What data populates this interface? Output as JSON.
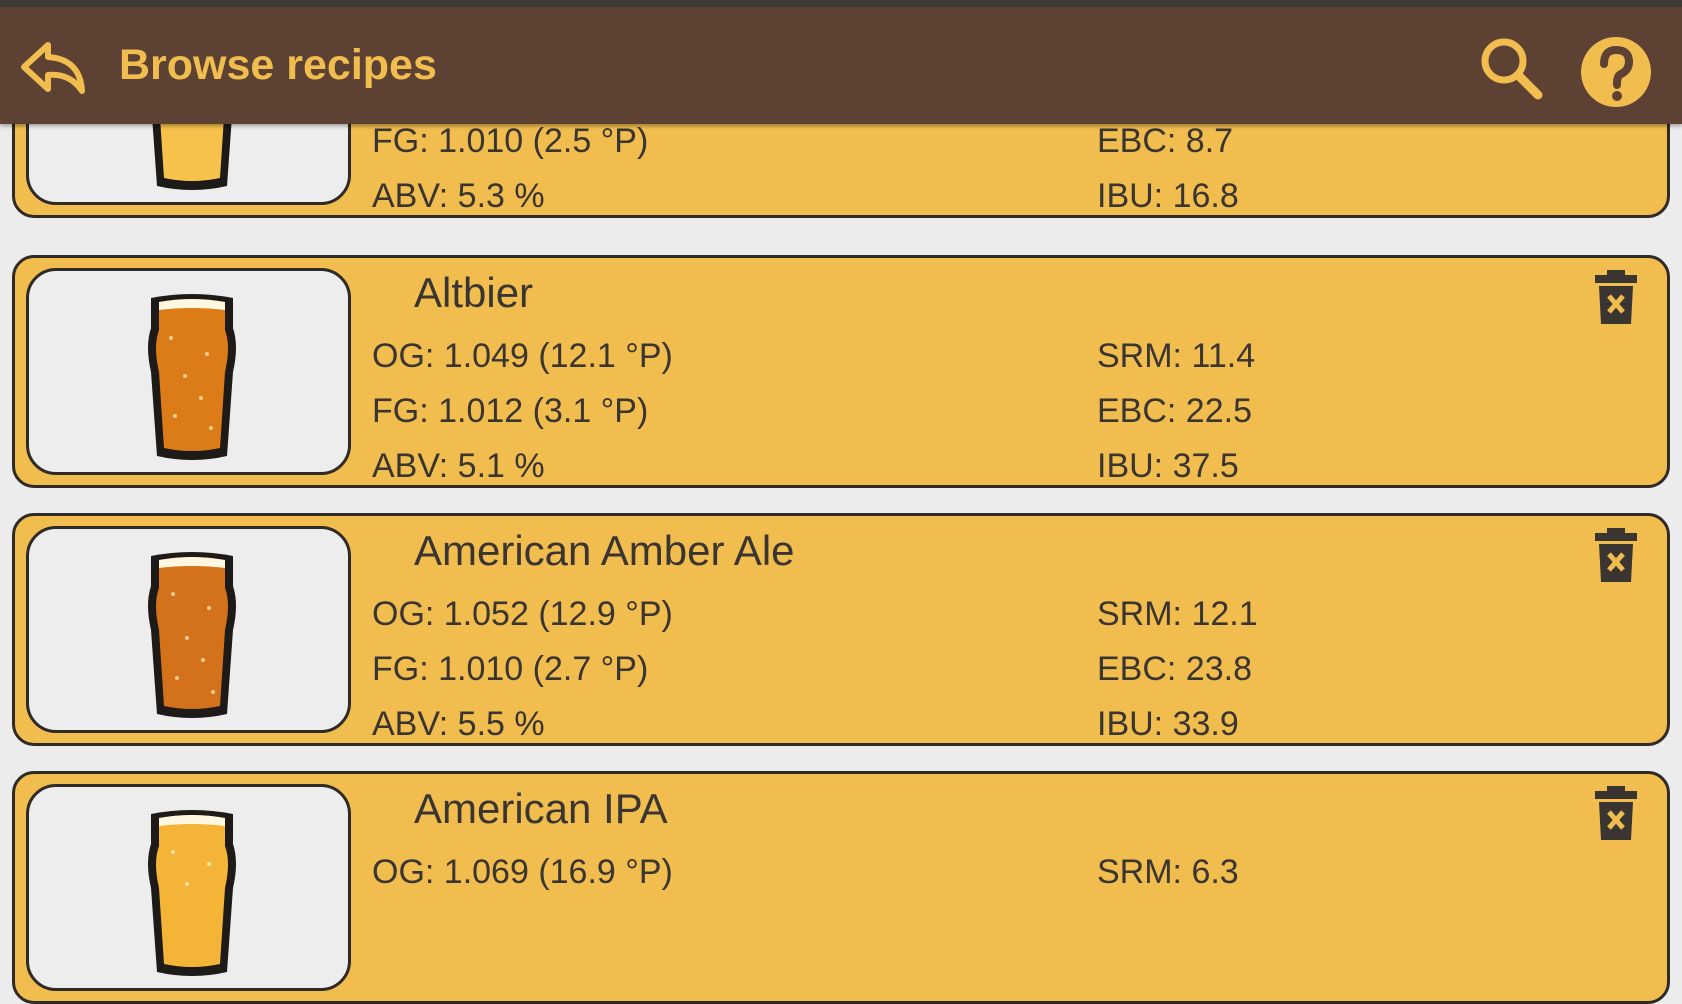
{
  "app_bar": {
    "title": "Browse recipes",
    "back_icon": "reply-back-icon",
    "search_icon": "search-icon",
    "help_icon": "help-circle-icon",
    "background": "#5d4133",
    "accent": "#f1bd4f"
  },
  "recipes": [
    {
      "name": "",
      "beer_color": "#f7c24c",
      "og": "",
      "fg": "FG: 1.010 (2.5 °P)",
      "abv": "ABV: 5.3 %",
      "srm": "",
      "ebc": "EBC: 8.7",
      "ibu": "IBU: 16.8"
    },
    {
      "name": "Altbier",
      "beer_color": "#db7c18",
      "og": "OG: 1.049 (12.1 °P)",
      "fg": "FG: 1.012 (3.1 °P)",
      "abv": "ABV: 5.1 %",
      "srm": "SRM: 11.4",
      "ebc": "EBC: 22.5",
      "ibu": "IBU: 37.5",
      "delete_icon": "trash-icon"
    },
    {
      "name": "American Amber Ale",
      "beer_color": "#d3721a",
      "og": "OG: 1.052 (12.9 °P)",
      "fg": "FG: 1.010 (2.7 °P)",
      "abv": "ABV: 5.5 %",
      "srm": "SRM: 12.1",
      "ebc": "EBC: 23.8",
      "ibu": "IBU: 33.9",
      "delete_icon": "trash-icon"
    },
    {
      "name": "American IPA",
      "beer_color": "#f4b437",
      "og": "OG: 1.069 (16.9 °P)",
      "fg": "",
      "abv": "",
      "srm": "SRM: 6.3",
      "ebc": "",
      "ibu": "",
      "delete_icon": "trash-icon"
    }
  ]
}
